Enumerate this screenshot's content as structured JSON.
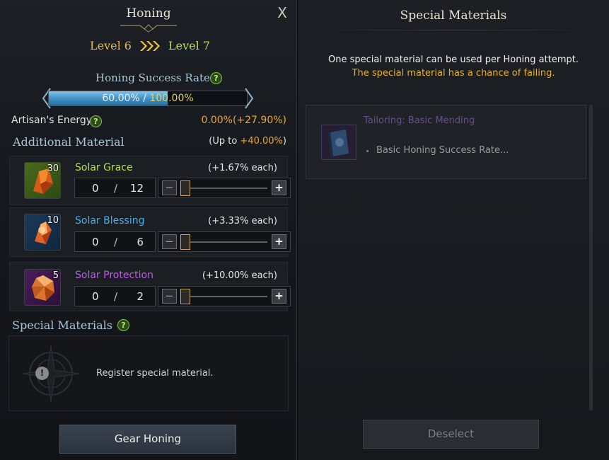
{
  "honing": {
    "title": "Honing",
    "close_label": "X",
    "level_from": "Level 6",
    "level_to": "Level 7",
    "success_rate_label": "Honing Success Rate",
    "rate_current": "60.00%",
    "rate_separator": " / ",
    "rate_max": "100.00%",
    "rate_fraction": 0.6,
    "artisan_label": "Artisan's Energy",
    "artisan_current": "0.00%",
    "artisan_add": "(+27.90%)",
    "additional_title": "Additional Material",
    "upto_prefix": "(Up to ",
    "upto_value": "+40.00%",
    "upto_suffix": ")",
    "materials": [
      {
        "name": "Solar Grace",
        "count": "30",
        "each": "(+1.67% each)",
        "value": "0",
        "sep": "/",
        "max": "12",
        "color": "#b8e04a"
      },
      {
        "name": "Solar Blessing",
        "count": "10",
        "each": "(+3.33% each)",
        "value": "0",
        "sep": "/",
        "max": "6",
        "color": "#4aaee8"
      },
      {
        "name": "Solar Protection",
        "count": "5",
        "each": "(+10.00% each)",
        "value": "0",
        "sep": "/",
        "max": "2",
        "color": "#c05ae8"
      }
    ],
    "slider_minus": "−",
    "slider_plus": "+",
    "special_title": "Special Materials",
    "special_msg": "Register special material.",
    "warn_glyph": "!",
    "gear_button": "Gear Honing"
  },
  "special_panel": {
    "title": "Special Materials",
    "note1": "One special material can be used per Honing attempt.",
    "note2": "The special material has a chance of failing.",
    "item_name": "Tailoring: Basic Mending",
    "item_desc": "Basic Honing Success Rate...",
    "deselect_button": "Deselect"
  },
  "help_glyph": "?"
}
